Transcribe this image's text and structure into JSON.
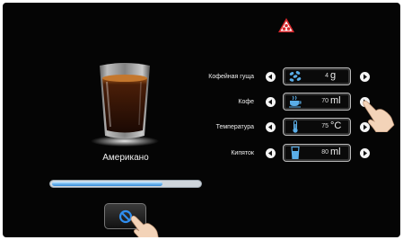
{
  "drink": {
    "name": "Американо"
  },
  "brew_progress": 0.73,
  "params": [
    {
      "label": "Кофейная гуща",
      "value": "4",
      "unit": "g",
      "icon": "coffee-beans-icon"
    },
    {
      "label": "Кофе",
      "value": "70",
      "unit": "ml",
      "icon": "coffee-cup-icon"
    },
    {
      "label": "Температура",
      "value": "75",
      "unit": "°C",
      "icon": "thermometer-icon"
    },
    {
      "label": "Кипяток",
      "value": "80",
      "unit": "ml",
      "icon": "water-glass-icon"
    }
  ],
  "colors": {
    "accent_blue": "#3a8dd8",
    "logo_red": "#d8262b"
  }
}
